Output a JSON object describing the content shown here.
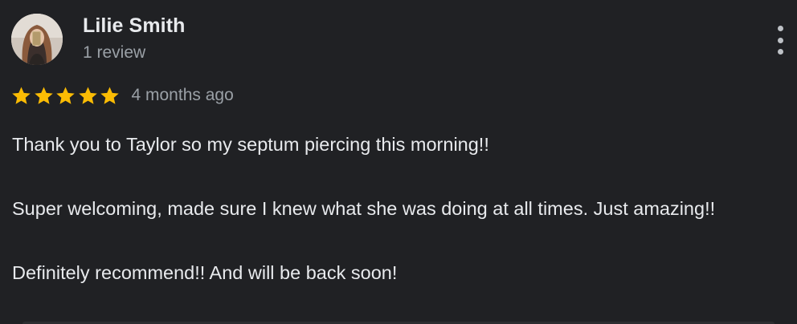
{
  "reviewer": {
    "name": "Lilie Smith",
    "review_count": "1 review"
  },
  "rating": {
    "stars": 5,
    "max_stars": 5,
    "star_color": "#fbbc04",
    "date": "4 months ago"
  },
  "review": {
    "paragraphs": [
      "Thank you to Taylor so my septum piercing this morning!!",
      "Super welcoming, made sure I knew what she was doing at all times. Just amazing!!",
      "Definitely recommend!! And will be back soon!"
    ]
  },
  "icons": {
    "more": "more-vert-icon",
    "star": "star-icon"
  },
  "colors": {
    "background": "#202124",
    "primary_text": "#e8eaed",
    "secondary_text": "#9aa0a6"
  }
}
